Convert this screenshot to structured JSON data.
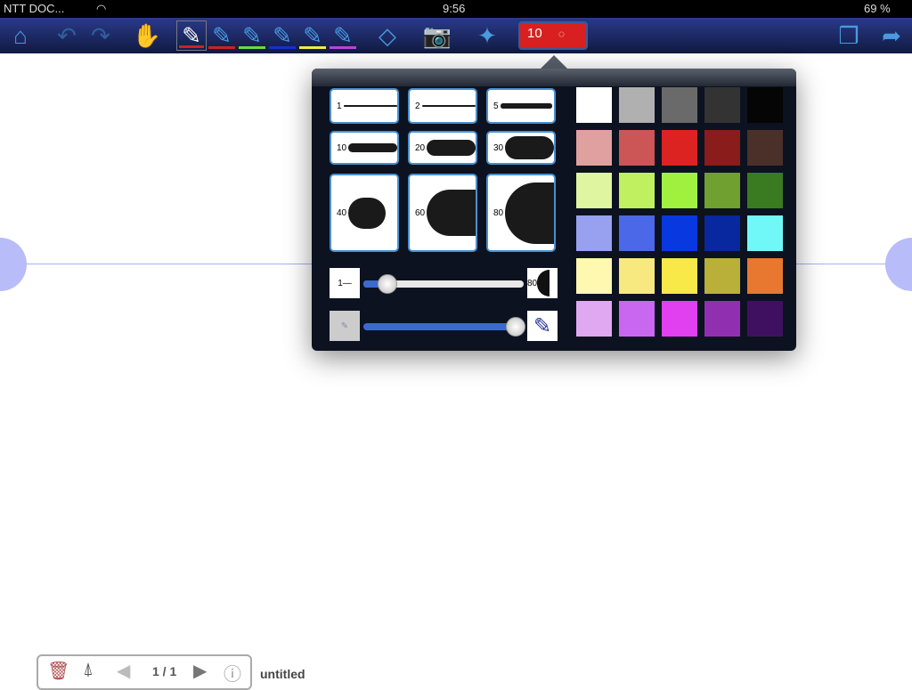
{
  "status": {
    "carrier": "NTT DOC...",
    "time": "9:56",
    "battery": "69 %"
  },
  "toolbar": {
    "size_value": "10",
    "pen_colors": [
      "#cc2222",
      "#cc2222",
      "#66dd44",
      "#1133cc",
      "#eeee44",
      "#bb44dd"
    ]
  },
  "widths": {
    "presets": [
      "1",
      "2",
      "5",
      "10",
      "20",
      "30",
      "40",
      "60",
      "80"
    ],
    "slider_min": "1",
    "slider_max": "80",
    "slider_value": 10,
    "opacity_value": 1.0
  },
  "palette": [
    [
      "#ffffff",
      "#b0b0b0",
      "#6a6a6a",
      "#333333",
      "#050505"
    ],
    [
      "#dfa0a0",
      "#cc5555",
      "#dd2222",
      "#8a1c1c",
      "#4a3028"
    ],
    [
      "#e0f5a0",
      "#c0f060",
      "#a0f040",
      "#70a030",
      "#3a7a20"
    ],
    [
      "#98a0f0",
      "#4a68e8",
      "#0838e0",
      "#0828a0",
      "#70f8f8"
    ],
    [
      "#fff8b0",
      "#f8e880",
      "#f8e848",
      "#b8b038",
      "#e87830"
    ],
    [
      "#e0a8f0",
      "#c868f0",
      "#e040f0",
      "#9030b0",
      "#401060"
    ]
  ],
  "bottom": {
    "page": "1 / 1",
    "title": "untitled"
  }
}
